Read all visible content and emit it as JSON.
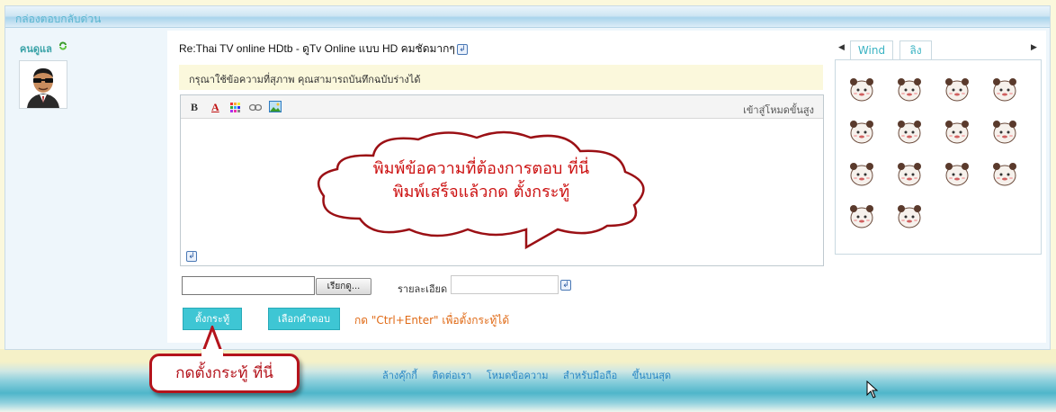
{
  "panel": {
    "title": "กล่องตอบกลับด่วน"
  },
  "user": {
    "name": "คนดูแล",
    "avatar": "sunglasses-man-avatar"
  },
  "reply": {
    "subject": "Re:Thai TV online HDtb - ดูTv Online แบบ HD คมชัดมากๆ",
    "notice": "กรุณาใช้ข้อความที่สุภาพ คุณสามารถบันทึกฉบับร่างได้",
    "advanced_mode": "เข้าสู่โหมดขั้นสูง",
    "toolbar": {
      "bold": "B",
      "color": "A"
    }
  },
  "bubble": {
    "line1": "พิมพ์ข้อความที่ต้องการตอบ ที่นี่",
    "line2": "พิมพ์เสร็จแล้วกด ตั้งกระทู้"
  },
  "captcha": {
    "button": "เรียกดู..."
  },
  "detail": {
    "label": "รายละเอียด"
  },
  "actions": {
    "post": "ตั้งกระทู้",
    "choose_reply": "เลือกคำตอบ",
    "shortcut": "กด \"Ctrl+Enter\" เพื่อตั้งกระทู้ได้"
  },
  "tabs": [
    {
      "label": "Wind",
      "active": true
    },
    {
      "label": "ลิง",
      "active": false
    }
  ],
  "emoticon_count": 14,
  "footer": {
    "links": [
      "ล้างคุ๊กกี้",
      "ติดต่อเรา",
      "โหมดข้อความ",
      "สำหรับมือถือ",
      "ขึ้นบนสุด"
    ]
  },
  "callout": {
    "text": "กดตั้งกระทู้ ที่นี่"
  },
  "colors": {
    "accent": "#3ec6d4",
    "callout": "#b4141c",
    "shortcut": "#e06a16",
    "link": "#2a87c5"
  }
}
